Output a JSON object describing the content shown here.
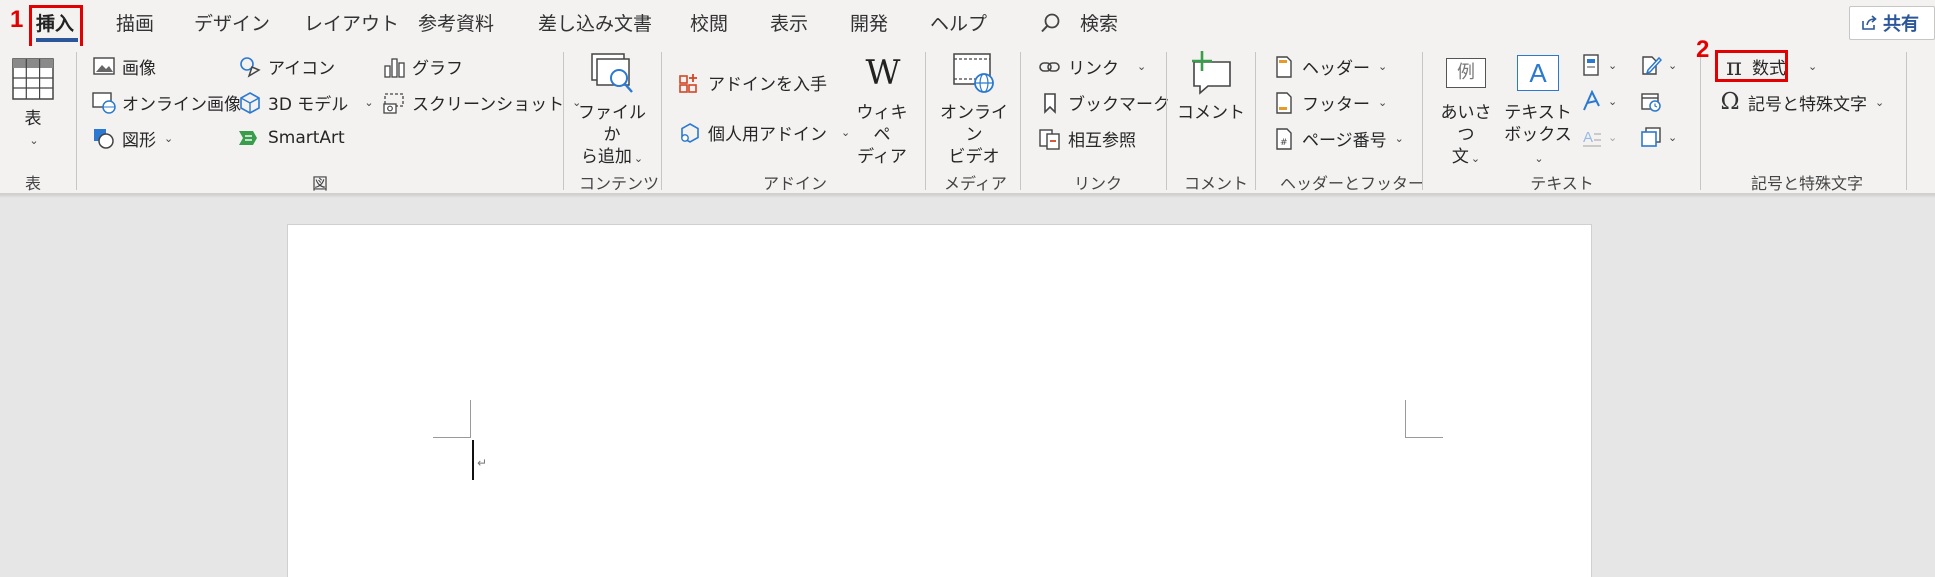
{
  "tabs": [
    "挿入",
    "描画",
    "デザイン",
    "レイアウト",
    "参考資料",
    "差し込み文書",
    "校閲",
    "表示",
    "開発",
    "ヘルプ"
  ],
  "search_label": "検索",
  "share_label": "共有",
  "annotations": {
    "step1": "1",
    "step2": "2"
  },
  "groups": {
    "table": {
      "button": "表",
      "label": "表"
    },
    "illustrations": {
      "label": "図",
      "picture": "画像",
      "online_picture": "オンライン画像",
      "shapes": "図形",
      "icons": "アイコン",
      "model3d": "3D モデル",
      "smartart": "SmartArt",
      "chart": "グラフ",
      "screenshot": "スクリーンショット"
    },
    "content": {
      "label": "コンテンツ",
      "button_line1": "ファイルか",
      "button_line2": "ら追加"
    },
    "addins": {
      "label": "アドイン",
      "get_addins": "アドインを入手",
      "my_addins": "個人用アドイン",
      "wiki_line1": "ウィキペ",
      "wiki_line2": "ディア"
    },
    "media": {
      "label": "メディア",
      "line1": "オンライン",
      "line2": "ビデオ"
    },
    "links": {
      "label": "リンク",
      "link": "リンク",
      "bookmark": "ブックマーク",
      "crossref": "相互参照"
    },
    "comments": {
      "label": "コメント",
      "comment": "コメント"
    },
    "header_footer": {
      "label": "ヘッダーとフッター",
      "header": "ヘッダー",
      "footer": "フッター",
      "page_number": "ページ番号"
    },
    "text": {
      "label": "テキスト",
      "greeting_line1": "あいさつ",
      "greeting_line2": "文",
      "textbox_line1": "テキスト",
      "textbox_line2": "ボックス",
      "greeting_icon_char": "例",
      "textbox_icon_char": "A"
    },
    "symbols": {
      "label": "記号と特殊文字",
      "equation": "数式",
      "symbol": "記号と特殊文字",
      "pi_char": "π",
      "omega_char": "Ω"
    }
  },
  "colors": {
    "accent": "#2b579a",
    "highlight": "#e30000",
    "ribbon_bg": "#f3f2f1",
    "canvas_bg": "#e6e6e6"
  }
}
